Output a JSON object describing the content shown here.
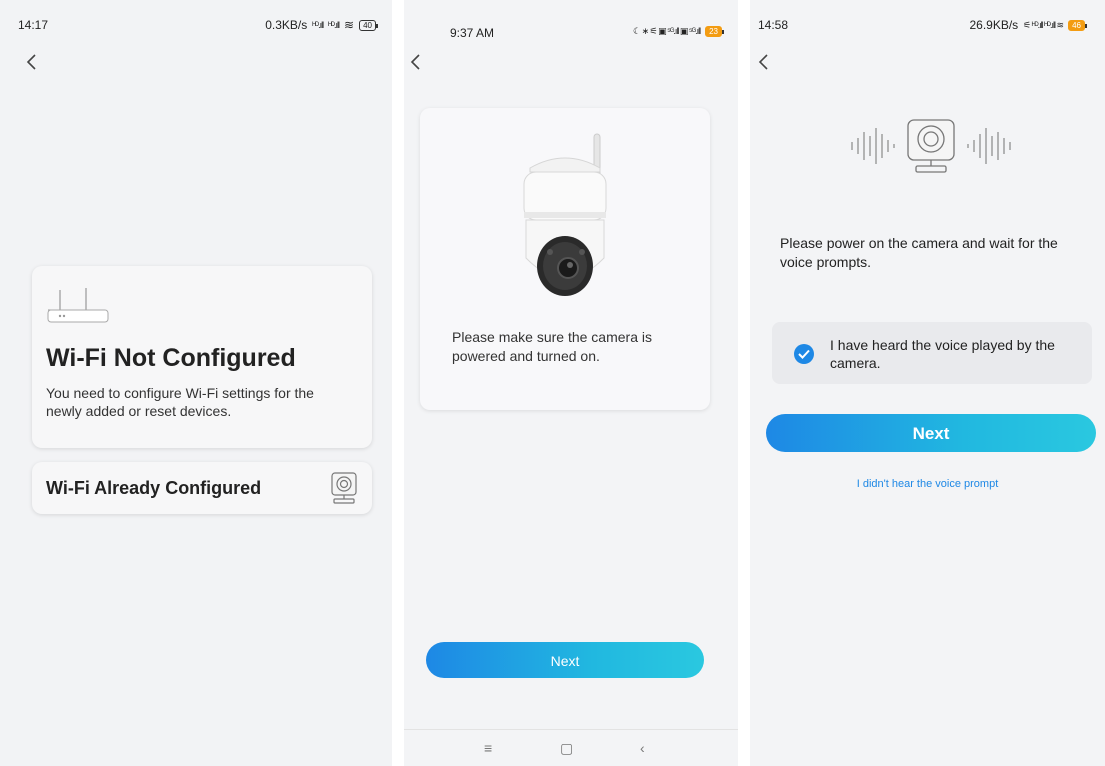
{
  "screen1": {
    "status": {
      "time": "14:17",
      "speed": "0.3KB/s",
      "signal1": "ᴴᴰ.ıll",
      "signal2": "ᴴᴰ.ıll",
      "wifi": "≋",
      "battery": "40"
    },
    "card_not_configured": {
      "title": "Wi-Fi Not Configured",
      "description": "You need to configure Wi-Fi settings for the newly added or reset devices."
    },
    "card_already_configured": {
      "label": "Wi-Fi Already Configured"
    }
  },
  "screen2": {
    "status": {
      "time": "9:37 AM",
      "icons": "☾ ∗ ⚟ ▣ ⁵ᴳ.ıll ▣ ⁵ᴳ.ıll",
      "battery": "23"
    },
    "instruction": "Please make sure the camera is powered and turned on.",
    "next_label": "Next",
    "nav": {
      "menu": "≡",
      "home": "▢",
      "back": "‹"
    }
  },
  "screen3": {
    "status": {
      "time": "14:58",
      "speed": "26.9KB/s",
      "icons": "⚟ ᴴᴰ.ıll ᴴᴰ.ıll ≋",
      "battery": "46"
    },
    "prompt": "Please power on the camera and wait for the voice prompts.",
    "checkbox_label": "I have heard the voice played by the camera.",
    "next_label": "Next",
    "link_label": "I didn't hear the voice prompt"
  },
  "colors": {
    "accent": "#1e88e5",
    "gradient_end": "#2ac8e0",
    "battery_orange": "#f39c12"
  }
}
